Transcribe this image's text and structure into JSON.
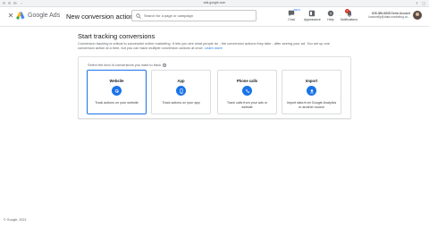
{
  "browser": {
    "url": "ads.google.com"
  },
  "header": {
    "logo_text": "Google Ads",
    "page_title": "New conversion action",
    "search_placeholder": "Search for a page or campaign",
    "items": [
      {
        "label": "Chat",
        "badge": "BETA"
      },
      {
        "label": "Appearance"
      },
      {
        "label": "Help"
      },
      {
        "label": "Notifications",
        "count": "1"
      }
    ],
    "account_name": "828-386-6808 Demo Account",
    "account_email": "lucasmilly@data-marketing.co..."
  },
  "main": {
    "title": "Start tracking conversions",
    "description": "Conversion tracking is critical to successful online marketing. It lets you see what people do - the conversion actions they take - after seeing your ad. You set up one conversion action at a time, but you can track multiple conversion actions at once.",
    "learn_more": "Learn more",
    "prompt": "Select the kind of conversions you want to track",
    "cards": [
      {
        "title": "Website",
        "desc": "Track actions on your website",
        "icon": "cursor-click-icon",
        "selected": true
      },
      {
        "title": "App",
        "desc": "Track actions on your app",
        "icon": "smartphone-icon",
        "selected": false
      },
      {
        "title": "Phone calls",
        "desc": "Track calls from your ads or website",
        "icon": "phone-icon",
        "selected": false
      },
      {
        "title": "Import",
        "desc": "Import data from Google Analytics or another source",
        "icon": "upload-icon",
        "selected": false
      }
    ]
  },
  "footer": {
    "copyright": "© Google, 2023."
  },
  "colors": {
    "accent": "#1a73e8",
    "text": "#202124",
    "muted": "#5f6368"
  }
}
